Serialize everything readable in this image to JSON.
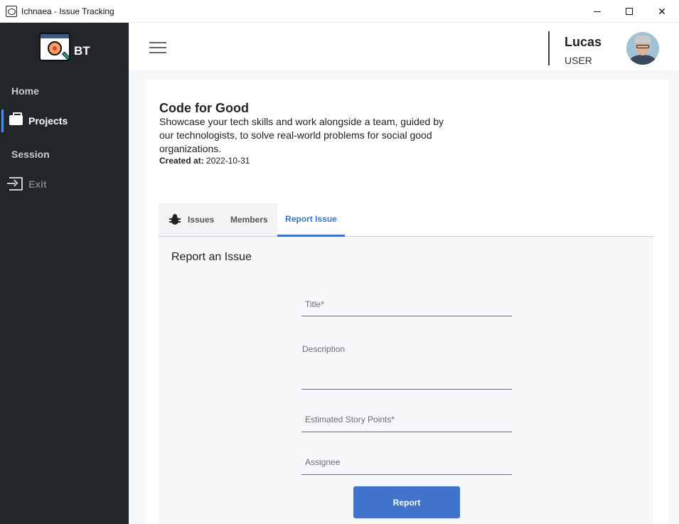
{
  "window": {
    "title": "Ichnaea - Issue Tracking",
    "minimize_icon": "minimize-icon",
    "maximize_icon": "maximize-icon",
    "close_icon": "close-icon"
  },
  "sidebar": {
    "logo_text": "BT",
    "items": [
      {
        "label": "Home"
      },
      {
        "label": "Projects",
        "icon": "briefcase-icon",
        "active": true
      },
      {
        "label": "Session"
      },
      {
        "label": "Exit",
        "icon": "exit-icon"
      }
    ]
  },
  "header": {
    "username": "Lucas",
    "role": "USER"
  },
  "project": {
    "title": "Code for Good",
    "description": "Showcase your tech skills and work alongside a team, guided by our technologists, to solve real-world problems for social good organizations.",
    "created_label": "Created at:",
    "created_value": "2022-10-31"
  },
  "tabs": [
    {
      "label": "Issues",
      "icon": "bug-icon"
    },
    {
      "label": "Members"
    },
    {
      "label": "Report Issue",
      "active": true
    }
  ],
  "form": {
    "heading": "Report an Issue",
    "title_label": "Title*",
    "description_label": "Description",
    "points_label": "Estimated Story Points*",
    "assignee_label": "Assignee",
    "submit_label": "Report"
  },
  "colors": {
    "sidebar_bg": "#22262b",
    "accent": "#3c74c9",
    "button_bg": "#3f73cc"
  }
}
